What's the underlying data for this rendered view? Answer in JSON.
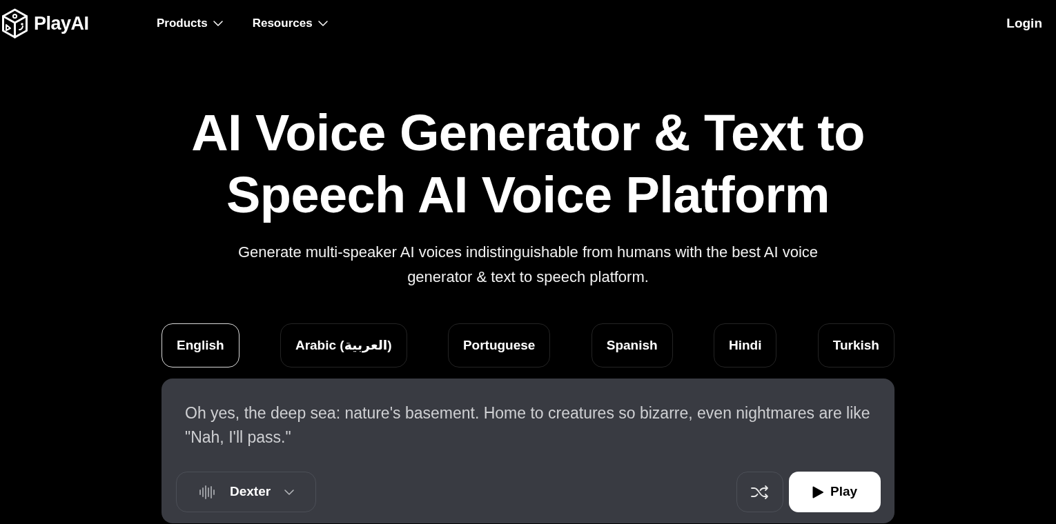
{
  "nav": {
    "brand": "PlayAI",
    "menus": [
      {
        "label": "Products"
      },
      {
        "label": "Resources"
      }
    ],
    "login": "Login"
  },
  "hero": {
    "title": "AI Voice Generator & Text to Speech AI Voice Platform",
    "subtitle": "Generate multi-speaker AI voices indistinguishable from humans with the best AI voice generator & text to speech platform."
  },
  "languages": [
    {
      "label": "English",
      "selected": true
    },
    {
      "label": "Arabic (العربية)",
      "selected": false
    },
    {
      "label": "Portuguese",
      "selected": false
    },
    {
      "label": "Spanish",
      "selected": false
    },
    {
      "label": "Hindi",
      "selected": false
    },
    {
      "label": "Turkish",
      "selected": false
    }
  ],
  "demo": {
    "text": "Oh yes, the deep sea: nature's basement. Home to creatures so bizarre, even nightmares are like \"Nah, I'll pass.\"",
    "voice": "Dexter",
    "play": "Play"
  }
}
